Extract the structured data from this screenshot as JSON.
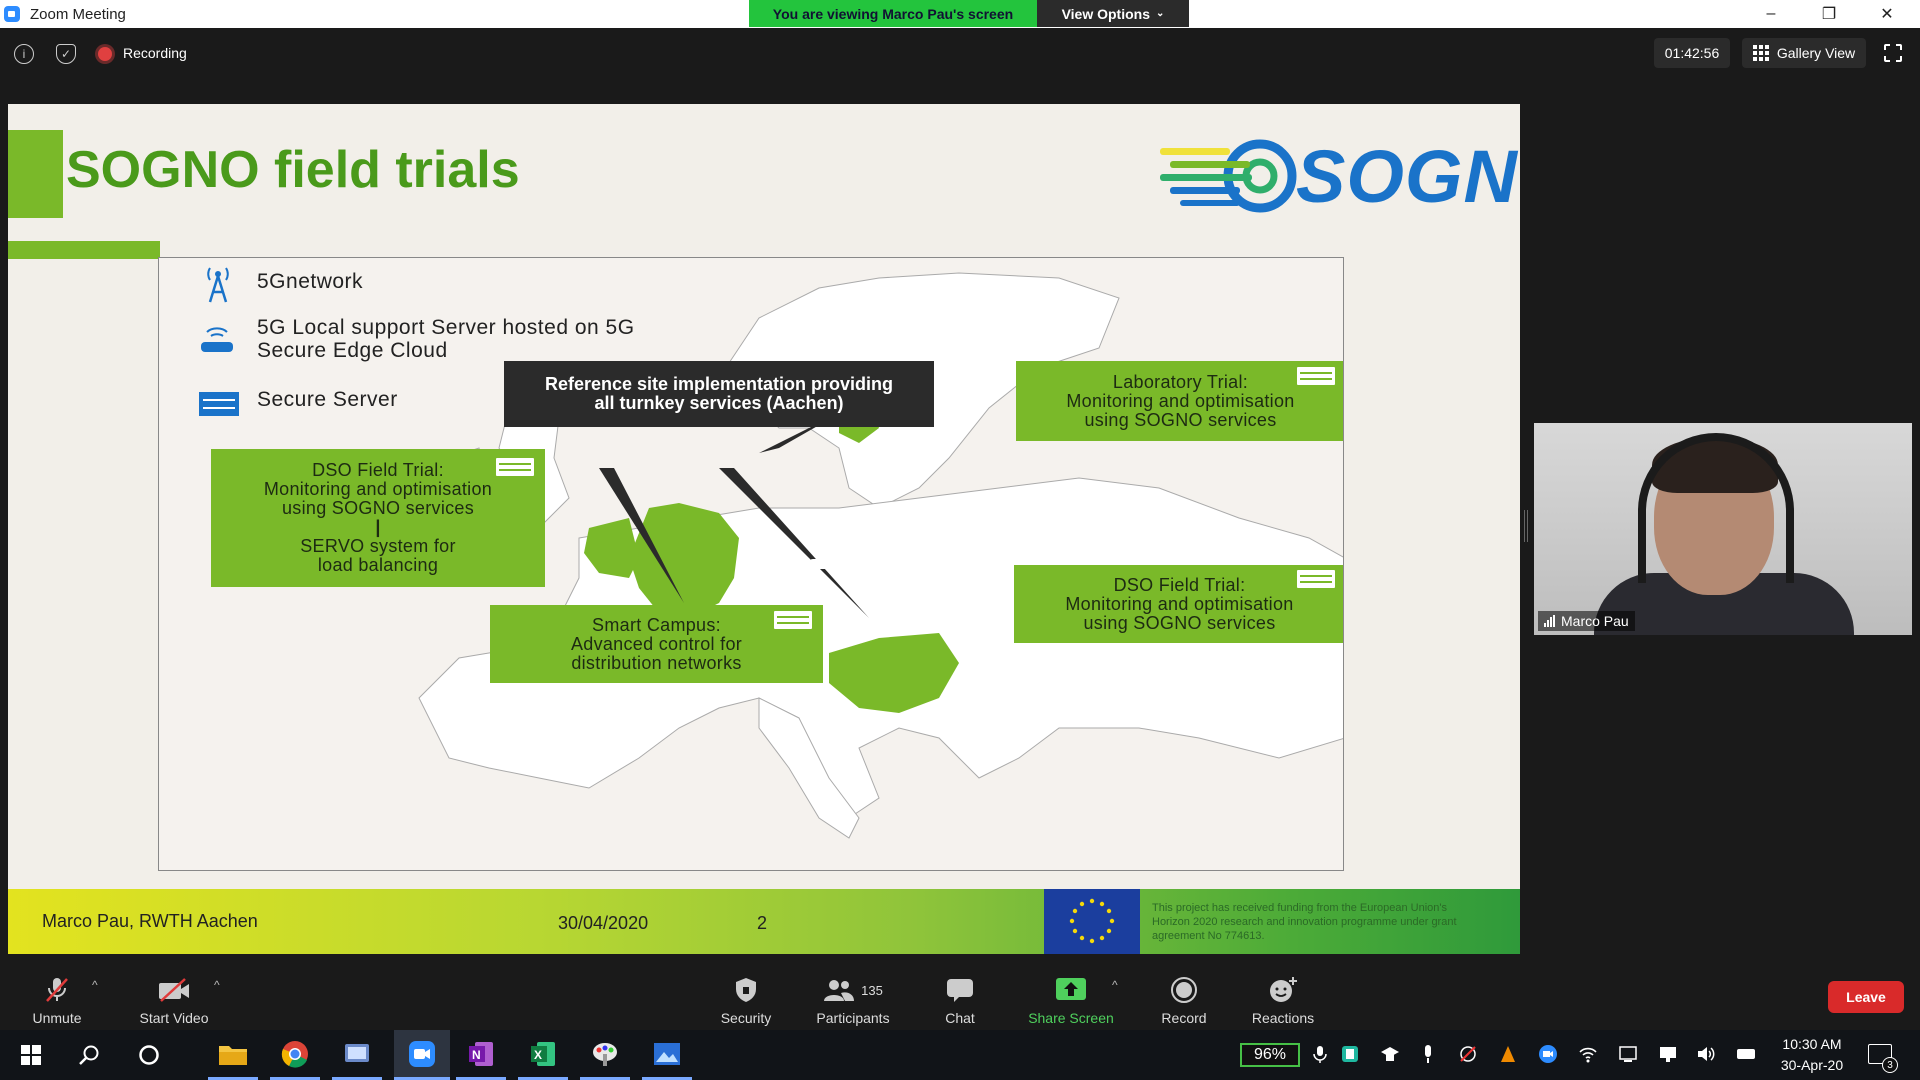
{
  "window": {
    "title": "Zoom Meeting",
    "viewing_banner": "You are viewing Marco Pau's screen",
    "view_options": "View Options",
    "minimize": "–",
    "restore": "❐",
    "close": "✕"
  },
  "topbar": {
    "recording_label": "Recording",
    "timer": "01:42:56",
    "gallery_view": "Gallery View"
  },
  "slide": {
    "title": "SOGNO field trials",
    "logo_text": "SOGNO",
    "legend": [
      {
        "icon": "antenna-icon",
        "label": "5Gnetwork"
      },
      {
        "icon": "router-icon",
        "label_line1": "5G Local support Server hosted on 5G",
        "label_line2": "Secure Edge Cloud"
      },
      {
        "icon": "server-icon",
        "label": "Secure Server"
      }
    ],
    "reference_callout": {
      "line1": "Reference site implementation providing",
      "line2": "all turnkey services (Aachen)"
    },
    "lab_trial": {
      "line1": "Laboratory Trial:",
      "line2": "Monitoring and optimisation",
      "line3": "using SOGNO services"
    },
    "dso_left": {
      "line1": "DSO Field Trial:",
      "line2": "Monitoring and optimisation",
      "line3": "using SOGNO services",
      "line4": "SERVO system for",
      "line5": "load balancing"
    },
    "dso_right": {
      "line1": "DSO Field Trial:",
      "line2": "Monitoring and optimisation",
      "line3": "using SOGNO services"
    },
    "smart_campus": {
      "line1": "Smart Campus:",
      "line2": "Advanced control for",
      "line3": "distribution networks"
    },
    "footer": {
      "author": "Marco Pau, RWTH Aachen",
      "date": "30/04/2020",
      "page": "2",
      "eu_text": "This project has received funding from the European Union's Horizon 2020 research and innovation programme under grant agreement No 774613."
    },
    "colors": {
      "green": "#7ab929",
      "title_green": "#4a9a1b",
      "logo_blue": "#1a73c9"
    }
  },
  "video": {
    "participant_name": "Marco Pau"
  },
  "toolbar": {
    "unmute": "Unmute",
    "start_video": "Start Video",
    "security": "Security",
    "participants": "Participants",
    "participants_count": "135",
    "chat": "Chat",
    "share_screen": "Share Screen",
    "record": "Record",
    "reactions": "Reactions",
    "leave": "Leave"
  },
  "taskbar": {
    "battery": "96%",
    "time": "10:30 AM",
    "date": "30-Apr-20",
    "notifications": "3"
  }
}
